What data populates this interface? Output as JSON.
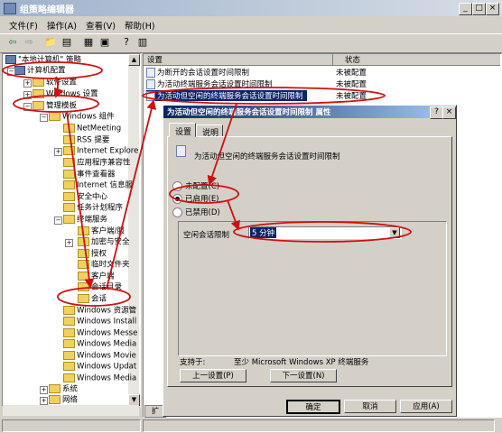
{
  "window": {
    "title": "组策略编辑器",
    "minimize": "_",
    "maximize": "□",
    "close": "×"
  },
  "menubar": {
    "items": [
      "文件(F)",
      "操作(A)",
      "查看(V)",
      "帮助(H)"
    ]
  },
  "tree": {
    "root": "\"本地计算机\" 策略",
    "items": [
      "计算机配置",
      "软件设置",
      "Windows 设置",
      "管理模板",
      "Windows 组件",
      "NetMeeting",
      "RSS 提要",
      "Internet Explore",
      "应用程序兼容性",
      "事件查看器",
      "Internet 信息服",
      "安全中心",
      "任务计划程序",
      "终端服务",
      "客户端/服",
      "加密与安全",
      "授权",
      "临时文件夹",
      "客户端",
      "会话目录",
      "会话",
      "Windows 资源管",
      "Windows Install",
      "Windows Messe",
      "Windows Media",
      "Windows Movie",
      "Windows Updat",
      "Windows Media",
      "系统",
      "网络"
    ]
  },
  "list": {
    "col_setting": "设置",
    "col_status": "状态",
    "rows": [
      {
        "name": "为断开的会话设置时间限制",
        "status": "未被配置"
      },
      {
        "name": "为活动终端服务会话设置时间限制",
        "status": "未被配置"
      },
      {
        "name": "为活动但空闲的终端服务会话设置时间限制",
        "status": "未被配置"
      }
    ],
    "bottom_tab": "扩"
  },
  "dialog": {
    "title": "为活动但空闲的终端服务会话设置时间限制 属性",
    "help_btn": "?",
    "close_btn": "×",
    "tab_settings": "设置",
    "tab_explain": "说明",
    "policy_name": "为活动但空闲的终端服务会话设置时间限制",
    "radio_notconfigured": "未配置(C)",
    "radio_enabled": "已启用(E)",
    "radio_disabled": "已禁用(D)",
    "limit_label": "空闲会话限制",
    "limit_value": "5 分钟",
    "supported_label": "支持于:",
    "supported_value": "至少 Microsoft Windows XP 终端服务",
    "prev_btn": "上一设置(P)",
    "next_btn": "下一设置(N)",
    "ok_btn": "确定",
    "cancel_btn": "取消",
    "apply_btn": "应用(A)"
  },
  "colors": {
    "annotation": "#d01010",
    "dialog_title": "#0a246a",
    "selected": "#0a246a"
  }
}
